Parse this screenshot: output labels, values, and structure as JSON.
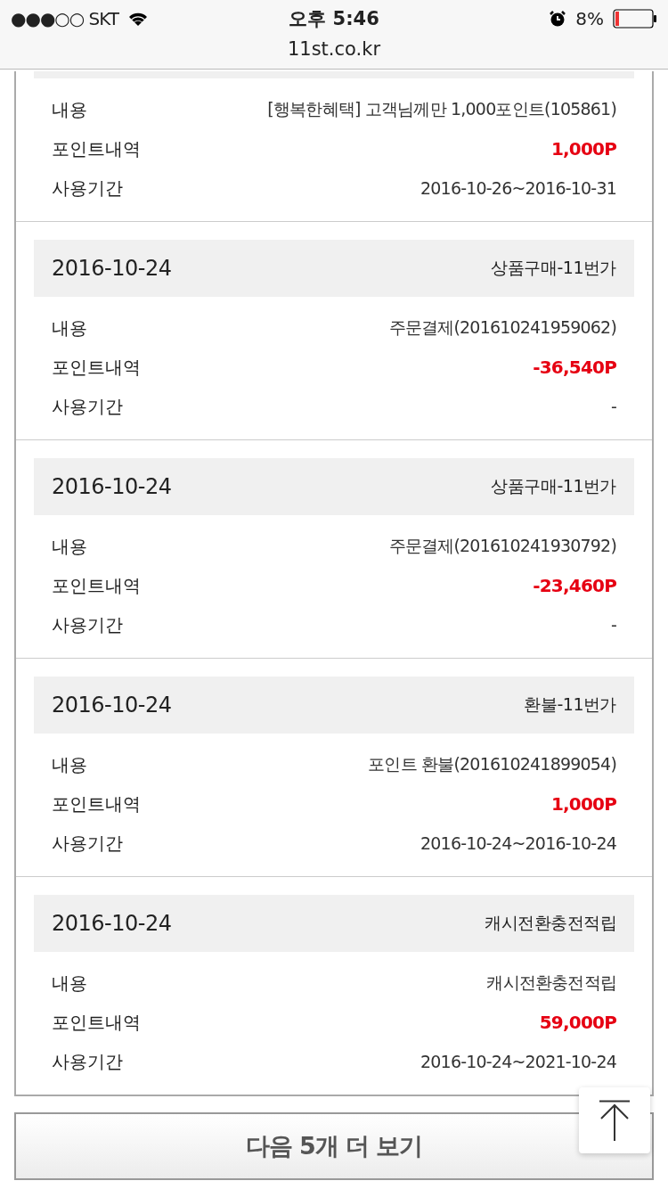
{
  "status_bar": {
    "carrier": "●●●○○ SKT",
    "time": "오후 5:46",
    "battery_text": "8%",
    "url": "11st.co.kr"
  },
  "partial_entry": {
    "rows": [
      {
        "label": "내용",
        "value": "[행복한혜택] 고객님께만 1,000포인트(105861)",
        "kind": "text"
      },
      {
        "label": "포인트내역",
        "value": "1,000P",
        "kind": "points"
      },
      {
        "label": "사용기간",
        "value": "2016-10-26~2016-10-31",
        "kind": "text"
      }
    ]
  },
  "entries": [
    {
      "date": "2016-10-24",
      "type": "상품구매-11번가",
      "rows": [
        {
          "label": "내용",
          "value": "주문결제(201610241959062)",
          "kind": "text"
        },
        {
          "label": "포인트내역",
          "value": "-36,540P",
          "kind": "points"
        },
        {
          "label": "사용기간",
          "value": "-",
          "kind": "text"
        }
      ]
    },
    {
      "date": "2016-10-24",
      "type": "상품구매-11번가",
      "rows": [
        {
          "label": "내용",
          "value": "주문결제(201610241930792)",
          "kind": "text"
        },
        {
          "label": "포인트내역",
          "value": "-23,460P",
          "kind": "points"
        },
        {
          "label": "사용기간",
          "value": "-",
          "kind": "text"
        }
      ]
    },
    {
      "date": "2016-10-24",
      "type": "환불-11번가",
      "rows": [
        {
          "label": "내용",
          "value": "포인트 환불(201610241899054)",
          "kind": "text"
        },
        {
          "label": "포인트내역",
          "value": "1,000P",
          "kind": "points"
        },
        {
          "label": "사용기간",
          "value": "2016-10-24~2016-10-24",
          "kind": "text"
        }
      ]
    },
    {
      "date": "2016-10-24",
      "type": "캐시전환충전적립",
      "rows": [
        {
          "label": "내용",
          "value": "캐시전환충전적립",
          "kind": "text"
        },
        {
          "label": "포인트내역",
          "value": "59,000P",
          "kind": "points"
        },
        {
          "label": "사용기간",
          "value": "2016-10-24~2021-10-24",
          "kind": "text"
        }
      ]
    }
  ],
  "more_button": "다음 5개 더 보기"
}
